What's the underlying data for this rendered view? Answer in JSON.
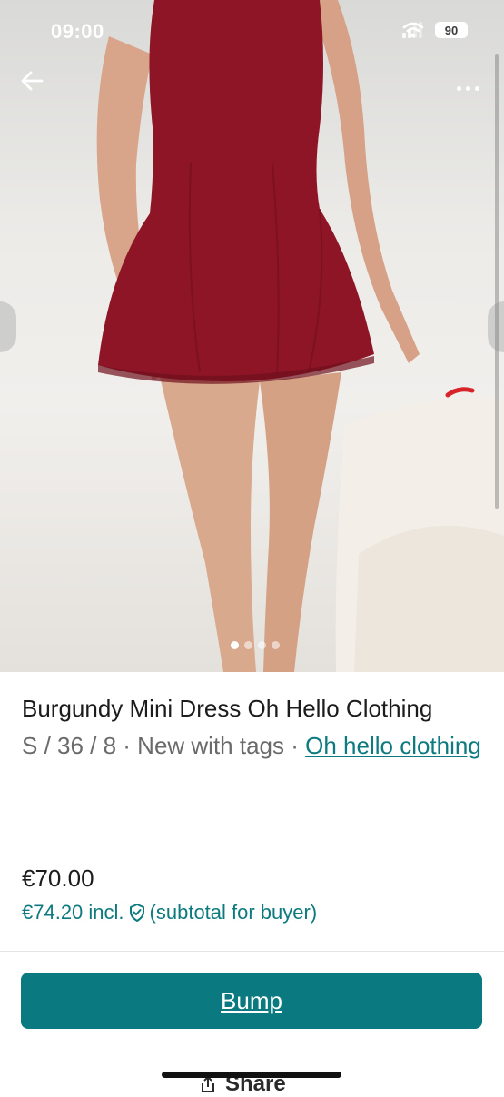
{
  "status_bar": {
    "time": "09:00",
    "battery": "90"
  },
  "item": {
    "title": "Burgundy Mini Dress Oh Hello Clothing",
    "details_prefix": "S / 36 / 8 · New with tags · ",
    "brand": "Oh hello clothing",
    "price": "€70.00",
    "price_incl": "€74.20 incl.",
    "price_incl_suffix": "(subtotal for buyer)"
  },
  "carousel": {
    "count": 4,
    "active_index": 0
  },
  "actions": {
    "bump_label": "Bump",
    "share_label": "Share"
  },
  "icons": [
    "arrow-left-icon",
    "more-dots-icon",
    "signal-icon",
    "wifi-icon",
    "battery-icon",
    "shield-check-icon",
    "share-icon"
  ],
  "colors": {
    "accent": "#0b7a80",
    "dress": "#8e1526",
    "text": "#1c1c1c",
    "muted": "#6a6a6a"
  }
}
